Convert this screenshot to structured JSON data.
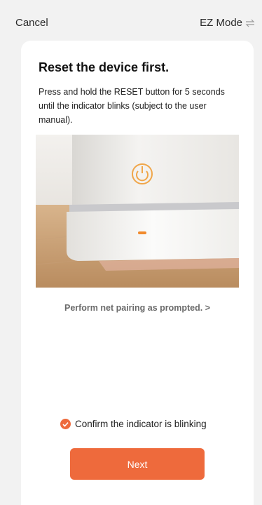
{
  "header": {
    "cancel_label": "Cancel",
    "mode_label": "EZ Mode",
    "mode_icon": "swap-arrows-icon"
  },
  "card": {
    "title": "Reset the device first.",
    "description": "Press and hold the RESET button for 5 seconds until the indicator blinks (subject to the user manual).",
    "link_text": "Perform net pairing as prompted. >",
    "confirm_text": "Confirm the indicator is blinking",
    "confirm_checked": true,
    "next_label": "Next"
  },
  "colors": {
    "accent": "#ee6a3c",
    "background": "#f2f2f2",
    "card": "#ffffff"
  }
}
